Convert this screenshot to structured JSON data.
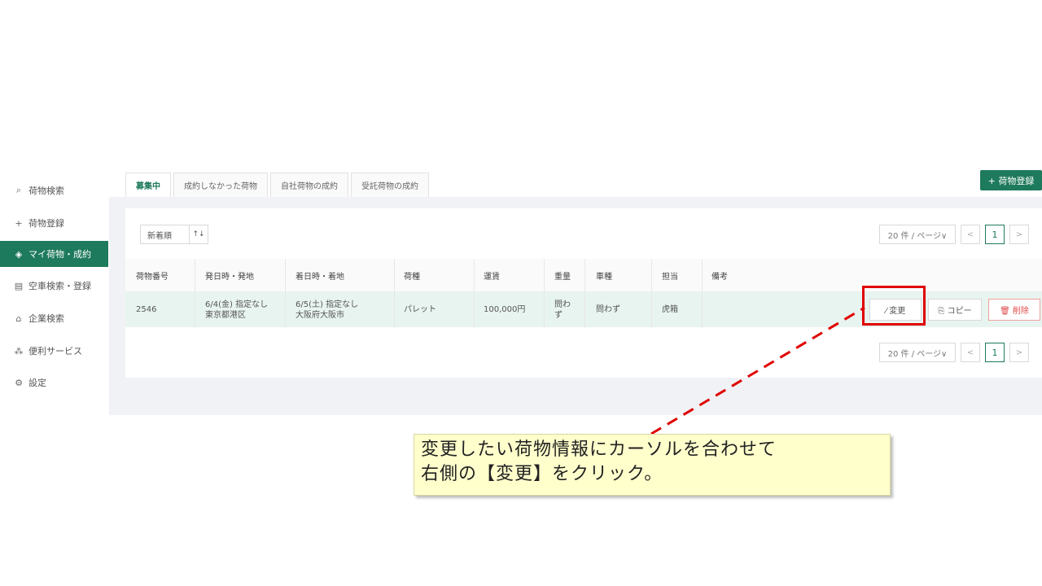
{
  "sidebar": {
    "items": [
      {
        "icon": "search-icon",
        "glyph": "⌕",
        "label": "荷物検索"
      },
      {
        "icon": "plus-icon",
        "glyph": "+",
        "label": "荷物登録"
      },
      {
        "icon": "cube-icon",
        "glyph": "◈",
        "label": "マイ荷物・成約"
      },
      {
        "icon": "truck-grid-icon",
        "glyph": "▤",
        "label": "空車検索・登録"
      },
      {
        "icon": "building-icon",
        "glyph": "⌂",
        "label": "企業検索"
      },
      {
        "icon": "network-icon",
        "glyph": "⁂",
        "label": "便利サービス"
      },
      {
        "icon": "gear-icon",
        "glyph": "⚙",
        "label": "設定"
      }
    ],
    "active_index": 2
  },
  "tabs": [
    "募集中",
    "成約しなかった荷物",
    "自社荷物の成約",
    "受託荷物の成約"
  ],
  "add_button": "+ 荷物登録",
  "sort": {
    "label": "新着順",
    "icon": "sort-icon",
    "glyph": "↑↓"
  },
  "pagination": {
    "page_size": "20 件 / ページ∨",
    "prev": "<",
    "current": "1",
    "next": ">"
  },
  "table": {
    "headers": [
      "荷物番号",
      "発日時・発地",
      "着日時・着地",
      "荷種",
      "運賃",
      "重量",
      "車種",
      "担当",
      "備考"
    ],
    "row": {
      "id": "2546",
      "depart_date": "6/4(金) 指定なし",
      "depart_place": "東京都港区",
      "arrive_date": "6/5(土) 指定なし",
      "arrive_place": "大阪府大阪市",
      "cargo": "パレット",
      "fare": "100,000円",
      "weight_1": "問わ",
      "weight_2": "ず",
      "vehicle": "問わず",
      "staff": "虎箱",
      "note": ""
    }
  },
  "actions": {
    "edit": "⁄ 変更",
    "copy": "⎘ コピー",
    "delete": "🗑 削除"
  },
  "callout": {
    "line1": "変更したい荷物情報にカーソルを合わせて",
    "line2": "右側の【変更】をクリック。"
  },
  "colors": {
    "accent": "#1e7a5c",
    "highlight": "#e00000",
    "callout_bg": "#ffffcc"
  }
}
